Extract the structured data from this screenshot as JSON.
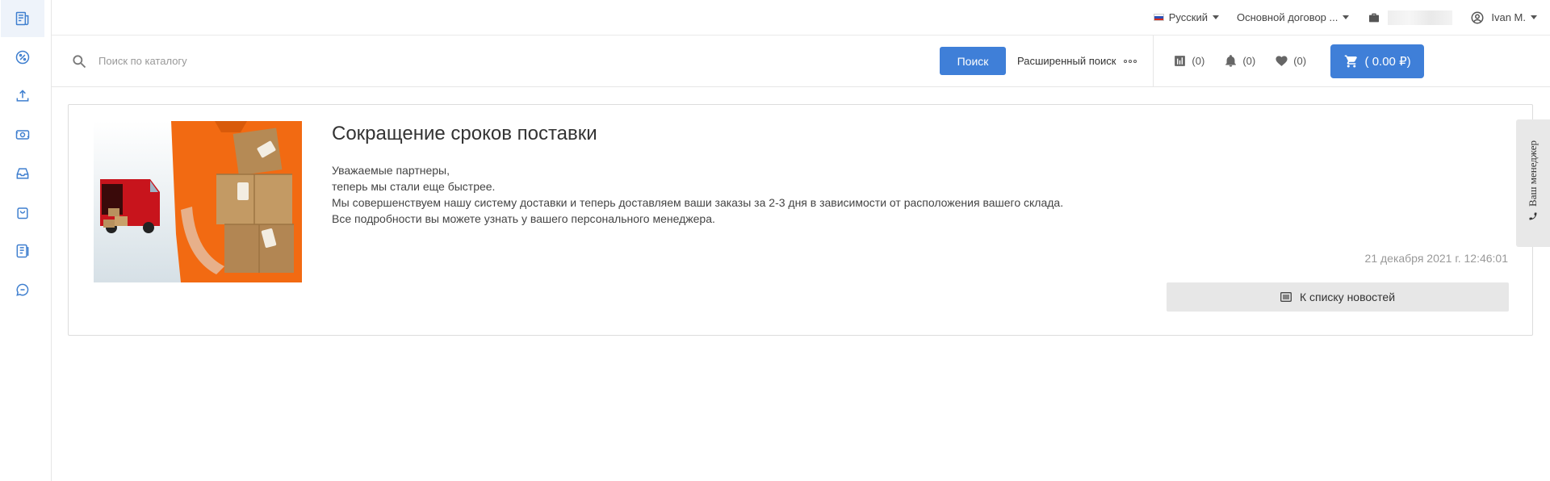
{
  "sidebar": {
    "items": [
      {
        "icon": "news-icon"
      },
      {
        "icon": "percent-icon"
      },
      {
        "icon": "upload-icon"
      },
      {
        "icon": "money-icon"
      },
      {
        "icon": "inbox-icon"
      },
      {
        "icon": "bag-icon"
      },
      {
        "icon": "catalog-icon"
      },
      {
        "icon": "chat-icon"
      }
    ]
  },
  "topbar": {
    "language": "Русский",
    "contract": "Основной договор ...",
    "user": "Ivan M."
  },
  "search": {
    "placeholder": "Поиск по каталогу",
    "button": "Поиск",
    "advanced": "Расширенный поиск",
    "compare_count": "(0)",
    "notifications_count": "(0)",
    "favorites_count": "(0)",
    "cart_total": "( 0.00 ₽)"
  },
  "news": {
    "title": "Сокращение сроков поставки",
    "paragraphs": [
      "Уважаемые партнеры,",
      "теперь мы стали еще быстрее.",
      "Мы совершенствуем нашу систему доставки и теперь доставляем ваши заказы за 2-3 дня в зависимости от расположения вашего склада.",
      "Все подробности вы можете узнать у вашего персонального менеджера."
    ],
    "date": "21 декабря 2021 г. 12:46:01",
    "back_button": "К списку новостей"
  },
  "manager_tab": "Ваш менеджер",
  "colors": {
    "accent": "#3f7fd8",
    "sidebar_icon": "#3f7fcf"
  }
}
